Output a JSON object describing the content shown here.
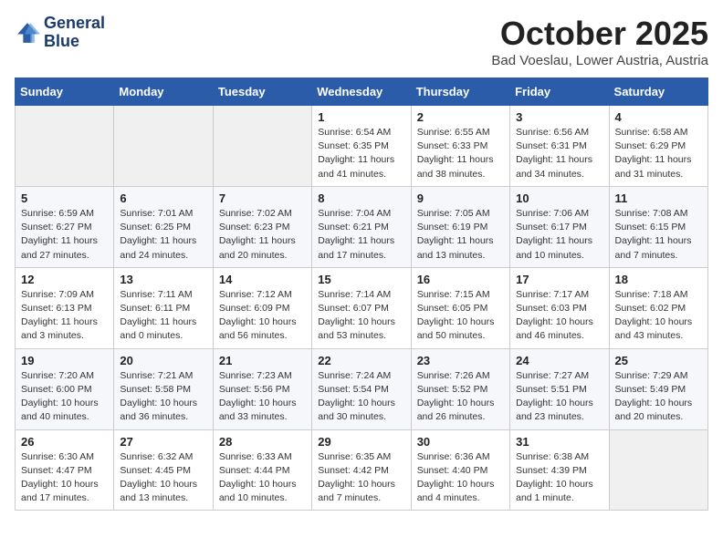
{
  "header": {
    "logo_line1": "General",
    "logo_line2": "Blue",
    "month": "October 2025",
    "location": "Bad Voeslau, Lower Austria, Austria"
  },
  "weekdays": [
    "Sunday",
    "Monday",
    "Tuesday",
    "Wednesday",
    "Thursday",
    "Friday",
    "Saturday"
  ],
  "weeks": [
    [
      {
        "day": "",
        "info": ""
      },
      {
        "day": "",
        "info": ""
      },
      {
        "day": "",
        "info": ""
      },
      {
        "day": "1",
        "info": "Sunrise: 6:54 AM\nSunset: 6:35 PM\nDaylight: 11 hours\nand 41 minutes."
      },
      {
        "day": "2",
        "info": "Sunrise: 6:55 AM\nSunset: 6:33 PM\nDaylight: 11 hours\nand 38 minutes."
      },
      {
        "day": "3",
        "info": "Sunrise: 6:56 AM\nSunset: 6:31 PM\nDaylight: 11 hours\nand 34 minutes."
      },
      {
        "day": "4",
        "info": "Sunrise: 6:58 AM\nSunset: 6:29 PM\nDaylight: 11 hours\nand 31 minutes."
      }
    ],
    [
      {
        "day": "5",
        "info": "Sunrise: 6:59 AM\nSunset: 6:27 PM\nDaylight: 11 hours\nand 27 minutes."
      },
      {
        "day": "6",
        "info": "Sunrise: 7:01 AM\nSunset: 6:25 PM\nDaylight: 11 hours\nand 24 minutes."
      },
      {
        "day": "7",
        "info": "Sunrise: 7:02 AM\nSunset: 6:23 PM\nDaylight: 11 hours\nand 20 minutes."
      },
      {
        "day": "8",
        "info": "Sunrise: 7:04 AM\nSunset: 6:21 PM\nDaylight: 11 hours\nand 17 minutes."
      },
      {
        "day": "9",
        "info": "Sunrise: 7:05 AM\nSunset: 6:19 PM\nDaylight: 11 hours\nand 13 minutes."
      },
      {
        "day": "10",
        "info": "Sunrise: 7:06 AM\nSunset: 6:17 PM\nDaylight: 11 hours\nand 10 minutes."
      },
      {
        "day": "11",
        "info": "Sunrise: 7:08 AM\nSunset: 6:15 PM\nDaylight: 11 hours\nand 7 minutes."
      }
    ],
    [
      {
        "day": "12",
        "info": "Sunrise: 7:09 AM\nSunset: 6:13 PM\nDaylight: 11 hours\nand 3 minutes."
      },
      {
        "day": "13",
        "info": "Sunrise: 7:11 AM\nSunset: 6:11 PM\nDaylight: 11 hours\nand 0 minutes."
      },
      {
        "day": "14",
        "info": "Sunrise: 7:12 AM\nSunset: 6:09 PM\nDaylight: 10 hours\nand 56 minutes."
      },
      {
        "day": "15",
        "info": "Sunrise: 7:14 AM\nSunset: 6:07 PM\nDaylight: 10 hours\nand 53 minutes."
      },
      {
        "day": "16",
        "info": "Sunrise: 7:15 AM\nSunset: 6:05 PM\nDaylight: 10 hours\nand 50 minutes."
      },
      {
        "day": "17",
        "info": "Sunrise: 7:17 AM\nSunset: 6:03 PM\nDaylight: 10 hours\nand 46 minutes."
      },
      {
        "day": "18",
        "info": "Sunrise: 7:18 AM\nSunset: 6:02 PM\nDaylight: 10 hours\nand 43 minutes."
      }
    ],
    [
      {
        "day": "19",
        "info": "Sunrise: 7:20 AM\nSunset: 6:00 PM\nDaylight: 10 hours\nand 40 minutes."
      },
      {
        "day": "20",
        "info": "Sunrise: 7:21 AM\nSunset: 5:58 PM\nDaylight: 10 hours\nand 36 minutes."
      },
      {
        "day": "21",
        "info": "Sunrise: 7:23 AM\nSunset: 5:56 PM\nDaylight: 10 hours\nand 33 minutes."
      },
      {
        "day": "22",
        "info": "Sunrise: 7:24 AM\nSunset: 5:54 PM\nDaylight: 10 hours\nand 30 minutes."
      },
      {
        "day": "23",
        "info": "Sunrise: 7:26 AM\nSunset: 5:52 PM\nDaylight: 10 hours\nand 26 minutes."
      },
      {
        "day": "24",
        "info": "Sunrise: 7:27 AM\nSunset: 5:51 PM\nDaylight: 10 hours\nand 23 minutes."
      },
      {
        "day": "25",
        "info": "Sunrise: 7:29 AM\nSunset: 5:49 PM\nDaylight: 10 hours\nand 20 minutes."
      }
    ],
    [
      {
        "day": "26",
        "info": "Sunrise: 6:30 AM\nSunset: 4:47 PM\nDaylight: 10 hours\nand 17 minutes."
      },
      {
        "day": "27",
        "info": "Sunrise: 6:32 AM\nSunset: 4:45 PM\nDaylight: 10 hours\nand 13 minutes."
      },
      {
        "day": "28",
        "info": "Sunrise: 6:33 AM\nSunset: 4:44 PM\nDaylight: 10 hours\nand 10 minutes."
      },
      {
        "day": "29",
        "info": "Sunrise: 6:35 AM\nSunset: 4:42 PM\nDaylight: 10 hours\nand 7 minutes."
      },
      {
        "day": "30",
        "info": "Sunrise: 6:36 AM\nSunset: 4:40 PM\nDaylight: 10 hours\nand 4 minutes."
      },
      {
        "day": "31",
        "info": "Sunrise: 6:38 AM\nSunset: 4:39 PM\nDaylight: 10 hours\nand 1 minute."
      },
      {
        "day": "",
        "info": ""
      }
    ]
  ]
}
